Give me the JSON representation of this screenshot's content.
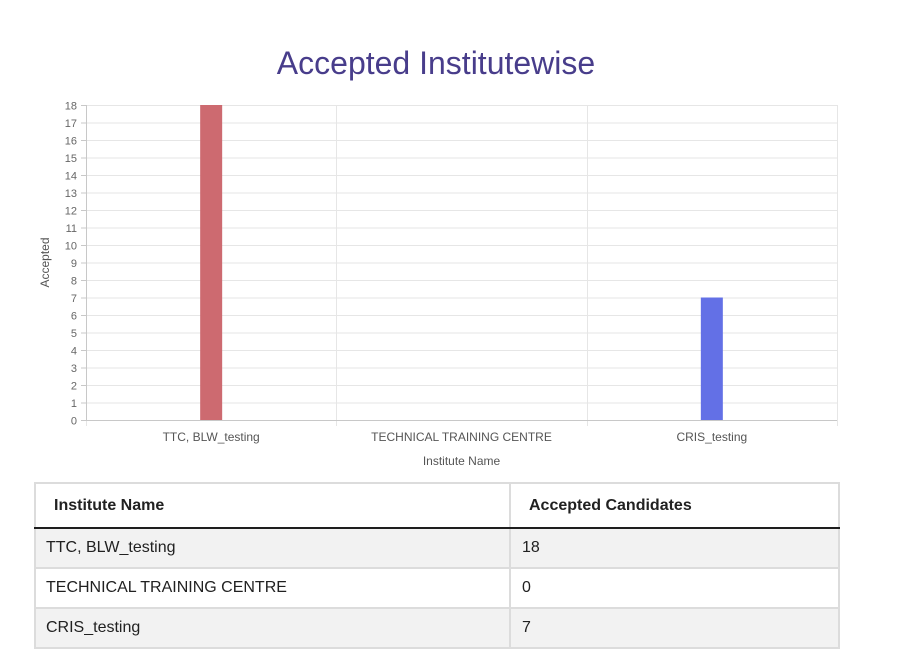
{
  "page": {
    "title": "Accepted Institutewise"
  },
  "chart_data": {
    "type": "bar",
    "title": "",
    "categories": [
      "TTC, BLW_testing",
      "TECHNICAL TRAINING CENTRE",
      "CRIS_testing"
    ],
    "values": [
      18,
      0,
      7
    ],
    "bar_colors": [
      "#cd6a70",
      "#8fbc8f",
      "#6370e6"
    ],
    "xlabel": "Institute Name",
    "ylabel": "Accepted",
    "ylim": [
      0,
      18
    ],
    "y_ticks": [
      "0",
      "1",
      "2",
      "3",
      "4",
      "5",
      "6",
      "7",
      "8",
      "9",
      "10",
      "11",
      "12",
      "13",
      "14",
      "15",
      "16",
      "17",
      "18"
    ],
    "grid": true,
    "legend": "none"
  },
  "table": {
    "headers": [
      "Institute Name",
      "Accepted Candidates"
    ],
    "rows": [
      {
        "name": "TTC, BLW_testing",
        "count": "18"
      },
      {
        "name": "TECHNICAL TRAINING CENTRE",
        "count": "0"
      },
      {
        "name": "CRIS_testing",
        "count": "7"
      }
    ]
  }
}
